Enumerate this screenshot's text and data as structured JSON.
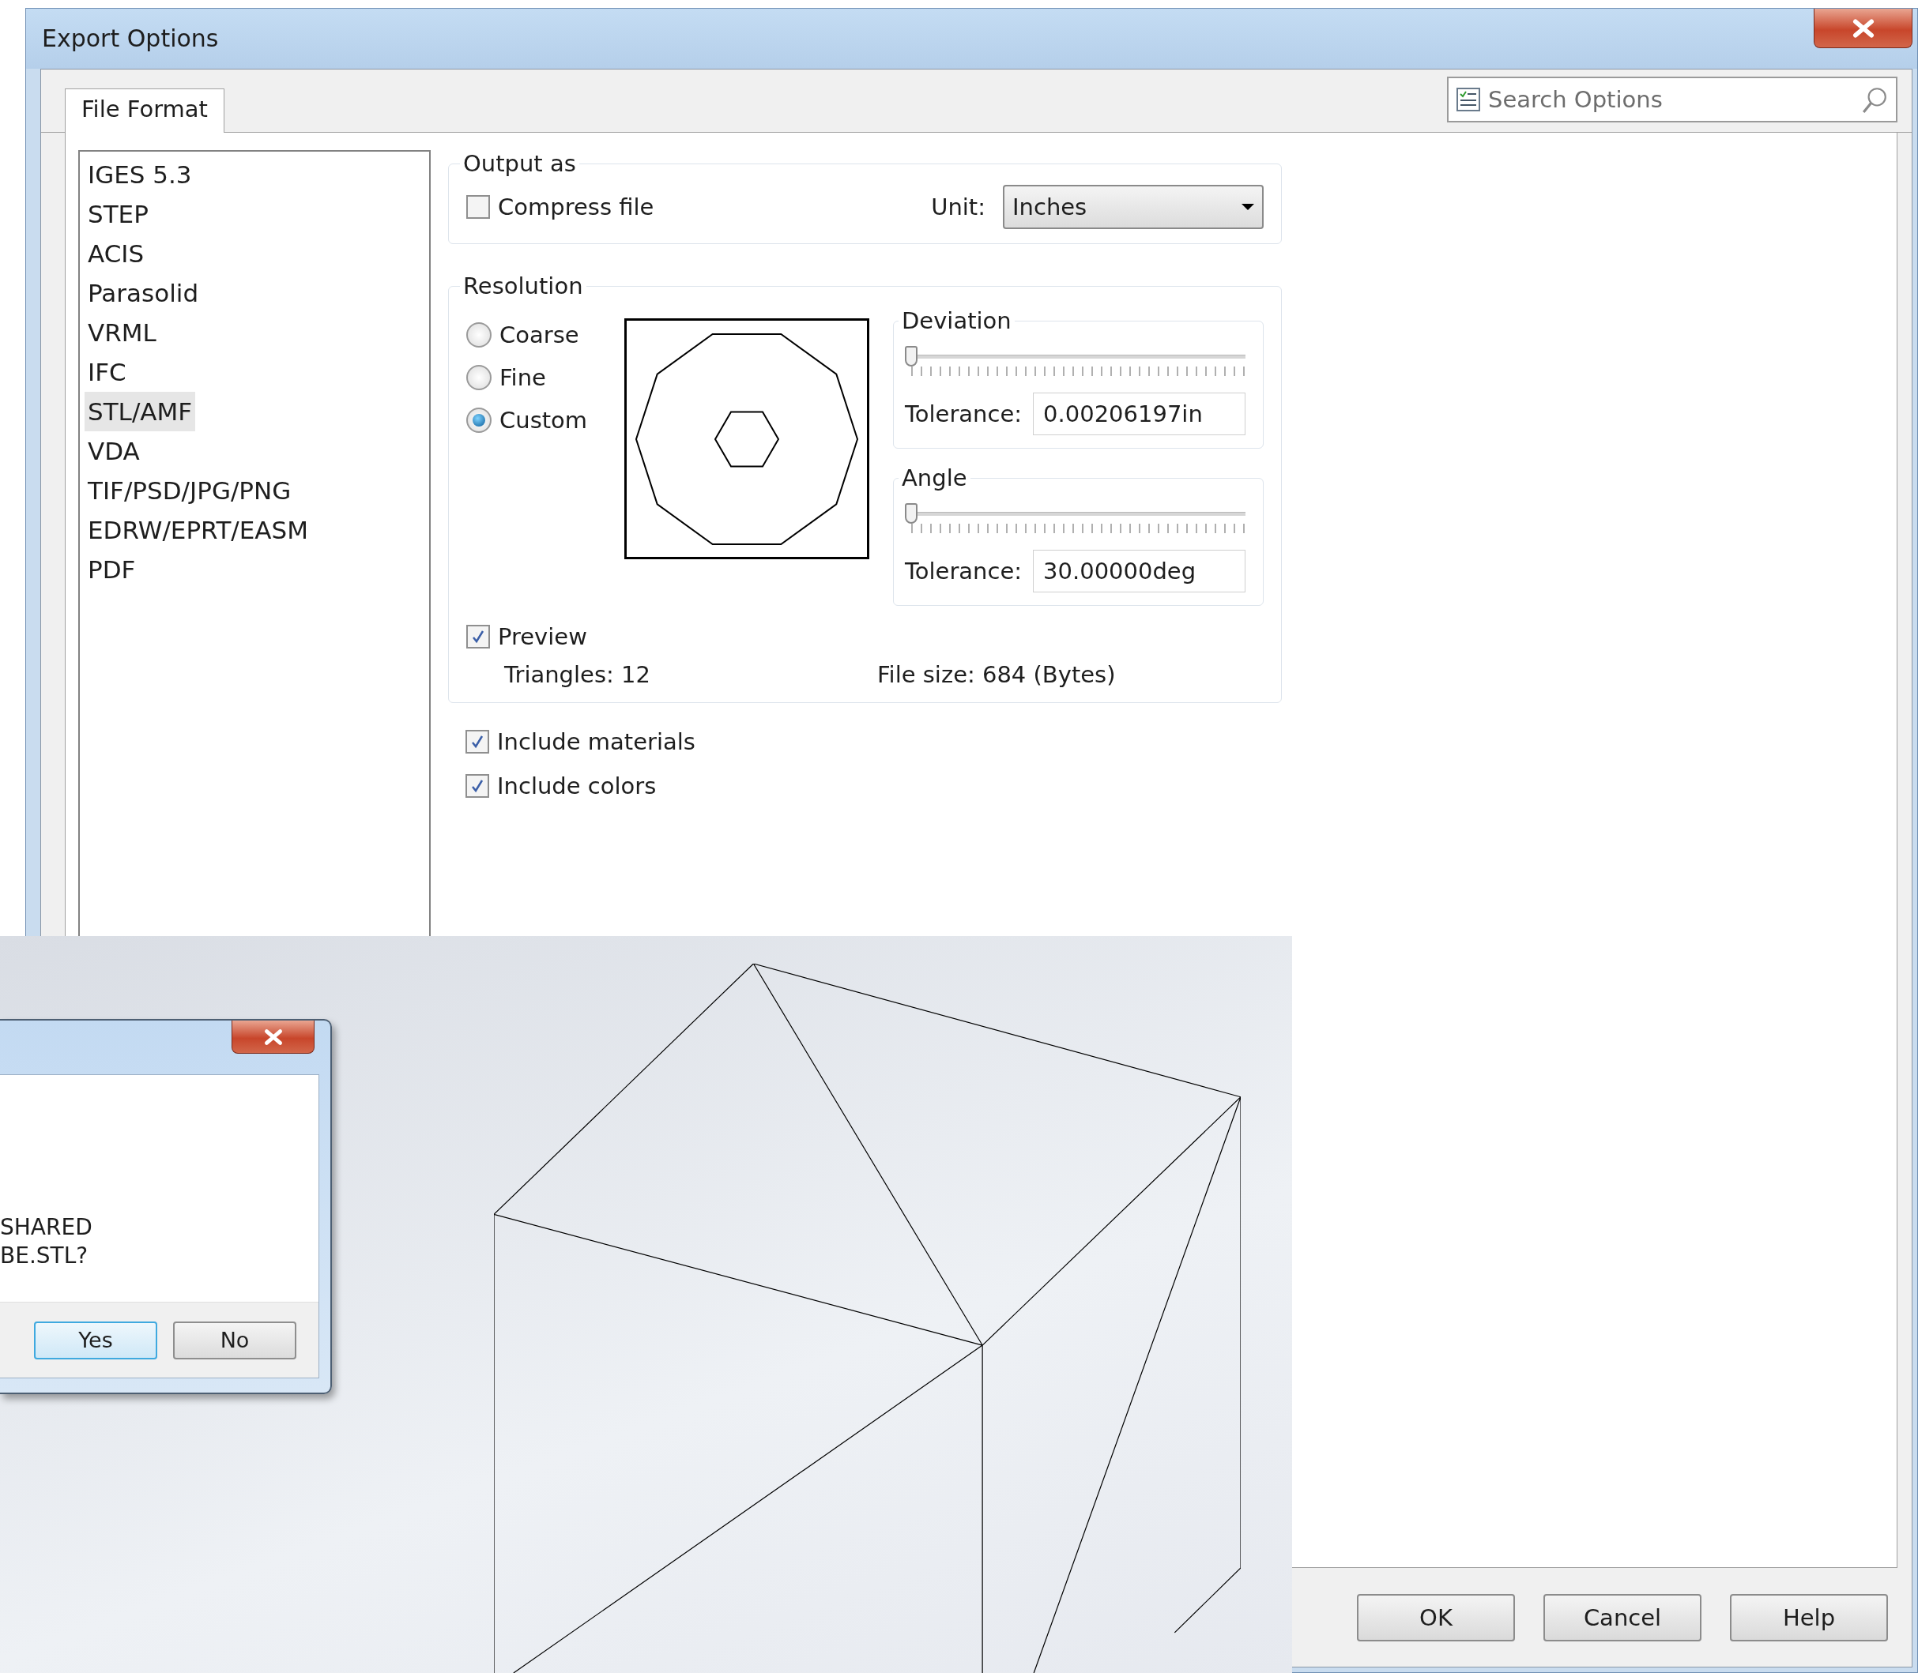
{
  "window": {
    "title": "Export Options"
  },
  "tabs": [
    {
      "label": "File Format",
      "selected": true
    }
  ],
  "search": {
    "placeholder": "Search Options"
  },
  "formats": [
    {
      "label": "IGES 5.3",
      "selected": false
    },
    {
      "label": "STEP",
      "selected": false
    },
    {
      "label": "ACIS",
      "selected": false
    },
    {
      "label": "Parasolid",
      "selected": false
    },
    {
      "label": "VRML",
      "selected": false
    },
    {
      "label": "IFC",
      "selected": false
    },
    {
      "label": "STL/AMF",
      "selected": true
    },
    {
      "label": "VDA",
      "selected": false
    },
    {
      "label": "TIF/PSD/JPG/PNG",
      "selected": false
    },
    {
      "label": "EDRW/EPRT/EASM",
      "selected": false
    },
    {
      "label": "PDF",
      "selected": false
    }
  ],
  "output_as": {
    "title": "Output as",
    "compress": {
      "label": "Compress file",
      "checked": false
    },
    "unit_label": "Unit:",
    "unit_value": "Inches"
  },
  "resolution": {
    "title": "Resolution",
    "options": [
      {
        "label": "Coarse",
        "selected": false
      },
      {
        "label": "Fine",
        "selected": false
      },
      {
        "label": "Custom",
        "selected": true
      }
    ],
    "deviation": {
      "title": "Deviation",
      "level": 0,
      "tolerance_label": "Tolerance:",
      "tolerance_value": "0.00206197in"
    },
    "angle": {
      "title": "Angle",
      "level": 0,
      "tolerance_label": "Tolerance:",
      "tolerance_value": "30.00000deg"
    },
    "preview": {
      "label": "Preview",
      "checked": true
    },
    "triangles_label": "Triangles:",
    "triangles_value": "12",
    "file_size_label": "File size:",
    "file_size_value": "684 (Bytes)"
  },
  "include_options": [
    {
      "label": "Include materials",
      "checked": true
    },
    {
      "label": "Include colors",
      "checked": true
    }
  ],
  "buttons": [
    {
      "label": "OK"
    },
    {
      "label": "Cancel"
    },
    {
      "label": "Help"
    }
  ],
  "prompt_dialog": {
    "message_lines": [
      "SHARED",
      "BE.STL?"
    ],
    "buttons": [
      {
        "label": "Yes",
        "default": true
      },
      {
        "label": "No",
        "default": false
      }
    ]
  }
}
